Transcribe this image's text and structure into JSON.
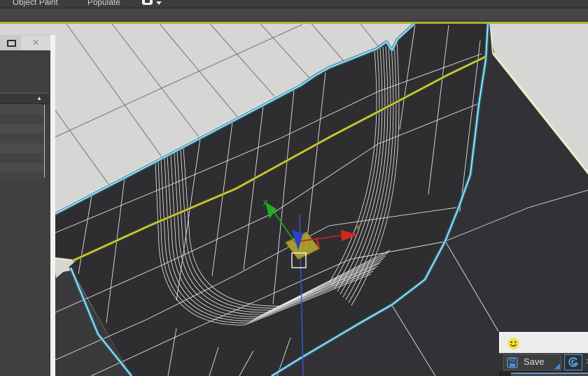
{
  "menu_bar": {
    "items": [
      {
        "label": "Object Paint"
      },
      {
        "label": "Populate"
      }
    ]
  },
  "left_panel": {
    "close_glyph": "✕",
    "sort_glyph": "▲"
  },
  "viewport": {
    "gizmo": {
      "x_label": "x",
      "y_label": "y"
    },
    "colors": {
      "background": "#d6d6d4",
      "mesh_surface": "#2e2e31",
      "wireframe": "#ececec",
      "selected_edge_cyan": "#b5ecf6",
      "edge_loop_yellow": "#e6e648",
      "object_border_cream": "#efeec9",
      "axis_x_red": "#d12a1a",
      "axis_y_green": "#1fae1f",
      "axis_z_blue": "#2b3fd4",
      "plane_handle": "#b3a52e",
      "active_viewport_border": "#b2b238"
    }
  },
  "status_panel": {
    "save_label": "Save",
    "maxscript_prompt": ">"
  }
}
